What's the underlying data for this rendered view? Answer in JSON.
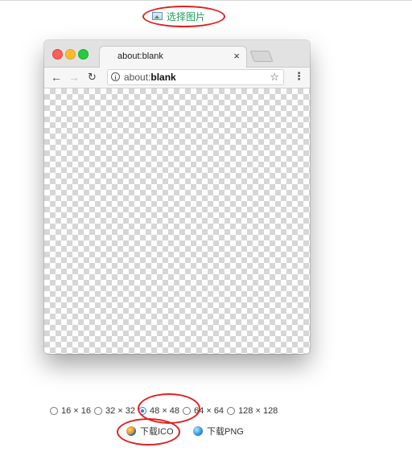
{
  "top": {
    "choose_label": "选择图片"
  },
  "browser": {
    "tab_title": "about:blank",
    "tab_close": "×",
    "url_prefix": "about:",
    "url_bold": "blank",
    "back": "←",
    "forward": "→",
    "reload": "↻",
    "star": "☆",
    "menu": "⋮",
    "info": "i"
  },
  "sizes": [
    {
      "label": "16 × 16",
      "selected": false
    },
    {
      "label": "32 × 32",
      "selected": false
    },
    {
      "label": "48 × 48",
      "selected": true
    },
    {
      "label": "64 × 64",
      "selected": false
    },
    {
      "label": "128 × 128",
      "selected": false
    }
  ],
  "downloads": {
    "ico_label": "下载ICO",
    "png_label": "下载PNG"
  },
  "colors": {
    "accent_green": "#1e9e5a",
    "annotation_red": "#e02020",
    "radio_blue": "#2a7fe0"
  }
}
